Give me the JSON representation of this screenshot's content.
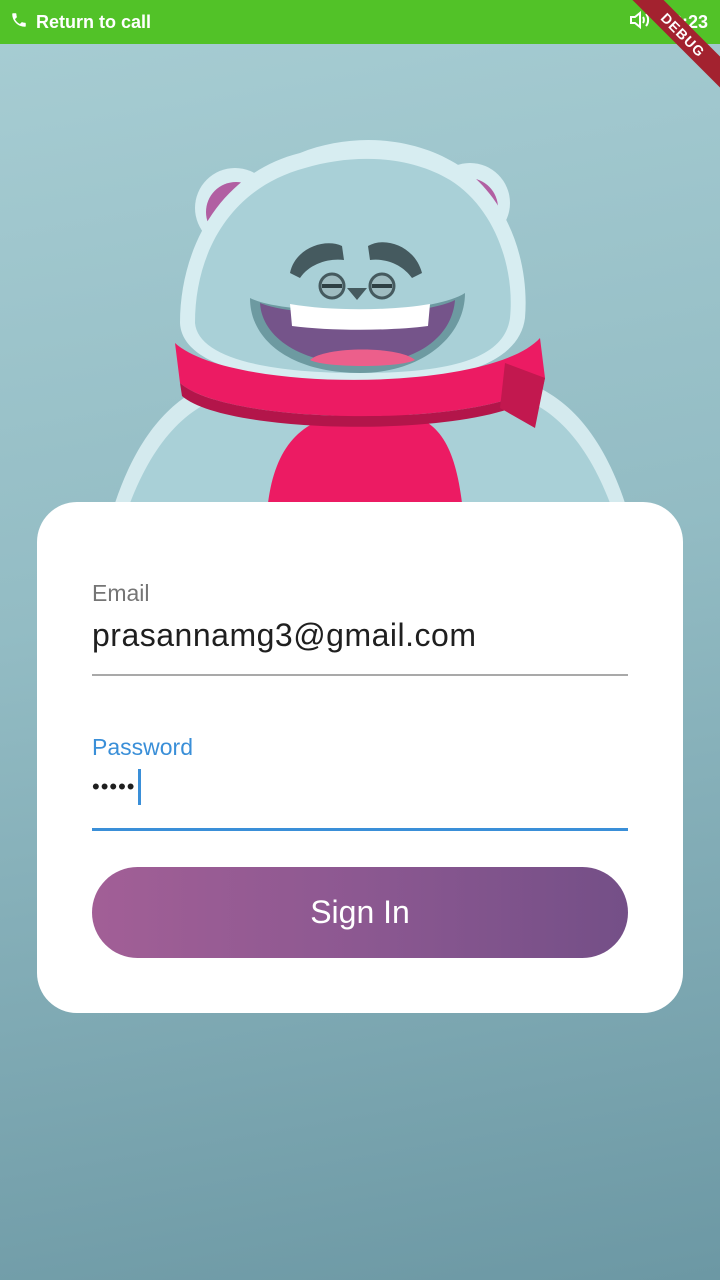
{
  "status_bar": {
    "call_text": "Return to call",
    "time": "22:23",
    "color": "#52c228"
  },
  "debug_banner": {
    "label": "DEBUG"
  },
  "form": {
    "email_label": "Email",
    "email_value": "prasannamg3@gmail.com",
    "password_label": "Password",
    "password_value": "•••••",
    "signin_label": "Sign In",
    "accent_color": "#3a8fd8"
  },
  "icons": [
    "phone-icon",
    "volume-icon",
    "bear-mascot-illustration"
  ]
}
